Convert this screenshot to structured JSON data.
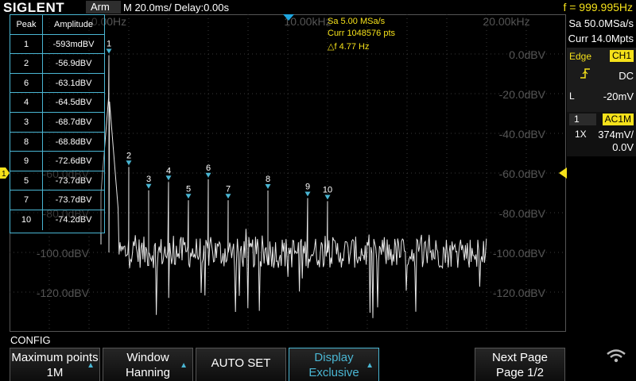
{
  "header": {
    "logo": "SIGLENT",
    "state": "Arm",
    "timebase": "M 20.0ms/ Delay:0.00s",
    "frequency": "f = 999.995Hz"
  },
  "fft_info": {
    "sample_rate": "Sa 5.00 MSa/s",
    "curr_points": "Curr 1048576 pts",
    "delta_f": "△f 4.77 Hz"
  },
  "freq_labels": [
    "0.00Hz",
    "10.00kHz",
    "20.00kHz"
  ],
  "db_labels_right": [
    "0.0dBV",
    "-20.0dBV",
    "-40.0dBV",
    "-60.0dBV",
    "-80.0dBV",
    "-100.0dBV",
    "-120.0dBV"
  ],
  "db_labels_left": [
    "-60.0dBV",
    "-80.0dBV",
    "-100.0dBV",
    "-120.0dBV"
  ],
  "right_panel": {
    "sample_rate": "Sa 50.0MSa/s",
    "curr_points": "Curr 14.0Mpts",
    "trigger_type": "Edge",
    "trigger_source": "CH1",
    "coupling": "DC",
    "level_label": "L",
    "level_value": "-20mV",
    "channel_num": "1",
    "channel_coupling": "AC1M",
    "probe": "1X",
    "volts_div": "374mV/",
    "offset": "0.0V"
  },
  "peak_table": {
    "headers": [
      "Peak",
      "Amplitude"
    ],
    "rows": [
      {
        "peak": "1",
        "amp": "-593mdBV"
      },
      {
        "peak": "2",
        "amp": "-56.9dBV"
      },
      {
        "peak": "6",
        "amp": "-63.1dBV"
      },
      {
        "peak": "4",
        "amp": "-64.5dBV"
      },
      {
        "peak": "3",
        "amp": "-68.7dBV"
      },
      {
        "peak": "8",
        "amp": "-68.8dBV"
      },
      {
        "peak": "9",
        "amp": "-72.6dBV"
      },
      {
        "peak": "5",
        "amp": "-73.7dBV"
      },
      {
        "peak": "7",
        "amp": "-73.7dBV"
      },
      {
        "peak": "10",
        "amp": "-74.2dBV"
      }
    ]
  },
  "channel_marker": "1",
  "menu": {
    "config_label": "CONFIG",
    "max_points_title": "Maximum points",
    "max_points_value": "1M",
    "window_title": "Window",
    "window_value": "Hanning",
    "auto_set": "AUTO SET",
    "display_title": "Display",
    "display_value": "Exclusive",
    "next_page_title": "Next Page",
    "next_page_value": "Page 1/2"
  },
  "colors": {
    "accent_yellow": "#f5e11a",
    "accent_cyan": "#4ab6d3",
    "trace": "#e6e6e6"
  },
  "chart_data": {
    "type": "line",
    "title": "",
    "xlabel": "",
    "ylabel": "",
    "xlim": [
      0,
      25000
    ],
    "ylim": [
      -140,
      20
    ],
    "x_unit": "Hz",
    "y_unit": "dBV",
    "noise_floor": -100,
    "peaks": [
      {
        "label": "1",
        "x": 0,
        "y": -0.593
      },
      {
        "label": "2",
        "x": 1000,
        "y": -56.9
      },
      {
        "label": "3",
        "x": 2000,
        "y": -68.7
      },
      {
        "label": "4",
        "x": 3000,
        "y": -64.5
      },
      {
        "label": "5",
        "x": 4000,
        "y": -73.7
      },
      {
        "label": "6",
        "x": 5000,
        "y": -63.1
      },
      {
        "label": "7",
        "x": 6000,
        "y": -73.7
      },
      {
        "label": "8",
        "x": 8000,
        "y": -68.8
      },
      {
        "label": "9",
        "x": 10000,
        "y": -72.6
      },
      {
        "label": "10",
        "x": 11000,
        "y": -74.2
      }
    ]
  }
}
